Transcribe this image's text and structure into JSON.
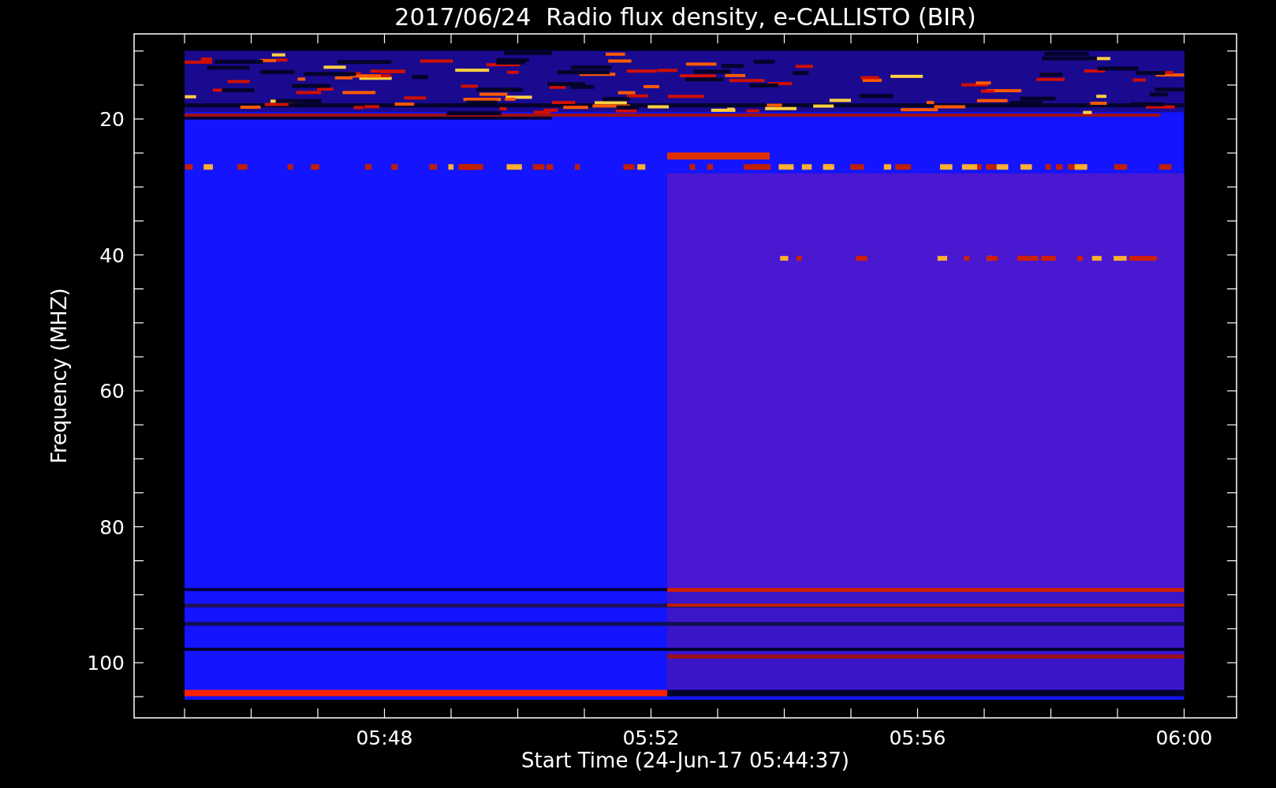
{
  "title": "2017/06/24  Radio flux density, e-CALLISTO (BIR)",
  "y_axis": {
    "label": "Frequency (MHZ)",
    "ticks": [
      "20",
      "40",
      "60",
      "80",
      "100"
    ]
  },
  "x_axis": {
    "label": "Start Time (24-Jun-17 05:44:37)",
    "ticks": [
      "05:48",
      "05:52",
      "05:56",
      "06:00"
    ]
  }
}
